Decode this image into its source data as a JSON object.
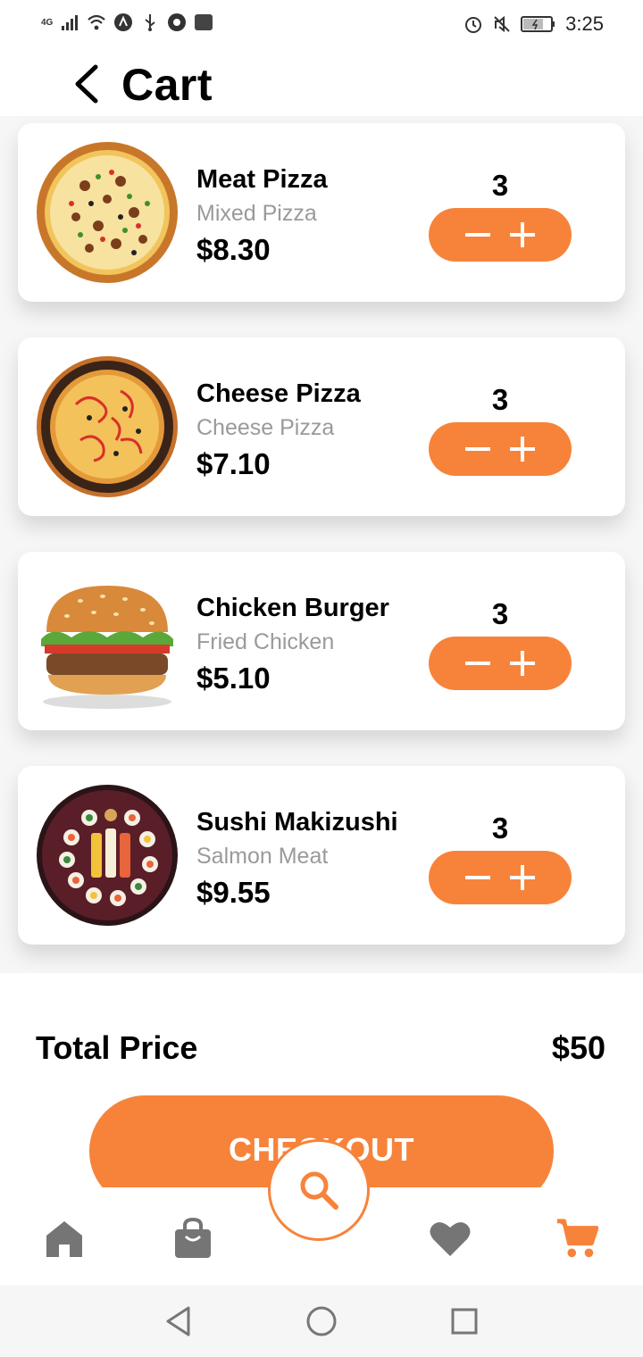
{
  "status_bar": {
    "time": "3:25",
    "network": "4G",
    "icons": [
      "signal-icon",
      "wifi-icon",
      "notification-icon",
      "usb-icon",
      "chrome-icon",
      "hms-icon",
      "alarm-icon",
      "mute-icon",
      "battery-icon"
    ]
  },
  "header": {
    "title": "Cart"
  },
  "colors": {
    "accent": "#f7833a",
    "muted": "#9a9a9a",
    "icon_gray": "#757575"
  },
  "cart": {
    "items": [
      {
        "name": "Meat Pizza",
        "subtitle": "Mixed Pizza",
        "price": "$8.30",
        "quantity": "3",
        "image": "meat-pizza-image"
      },
      {
        "name": "Cheese Pizza",
        "subtitle": "Cheese Pizza",
        "price": "$7.10",
        "quantity": "3",
        "image": "cheese-pizza-image"
      },
      {
        "name": "Chicken Burger",
        "subtitle": "Fried Chicken",
        "price": "$5.10",
        "quantity": "3",
        "image": "chicken-burger-image"
      },
      {
        "name": "Sushi Makizushi",
        "subtitle": "Salmon Meat",
        "price": "$9.55",
        "quantity": "3",
        "image": "sushi-image"
      }
    ]
  },
  "summary": {
    "total_label": "Total Price",
    "total_value": "$50",
    "checkout_label": "CHECKOUT"
  },
  "bottom_nav": {
    "items": [
      "home-icon",
      "shopping-bag-icon",
      "search-icon",
      "heart-icon",
      "cart-icon"
    ],
    "active": "cart-icon"
  },
  "system_nav": {
    "items": [
      "back-icon",
      "home-circle-icon",
      "recents-icon"
    ]
  }
}
